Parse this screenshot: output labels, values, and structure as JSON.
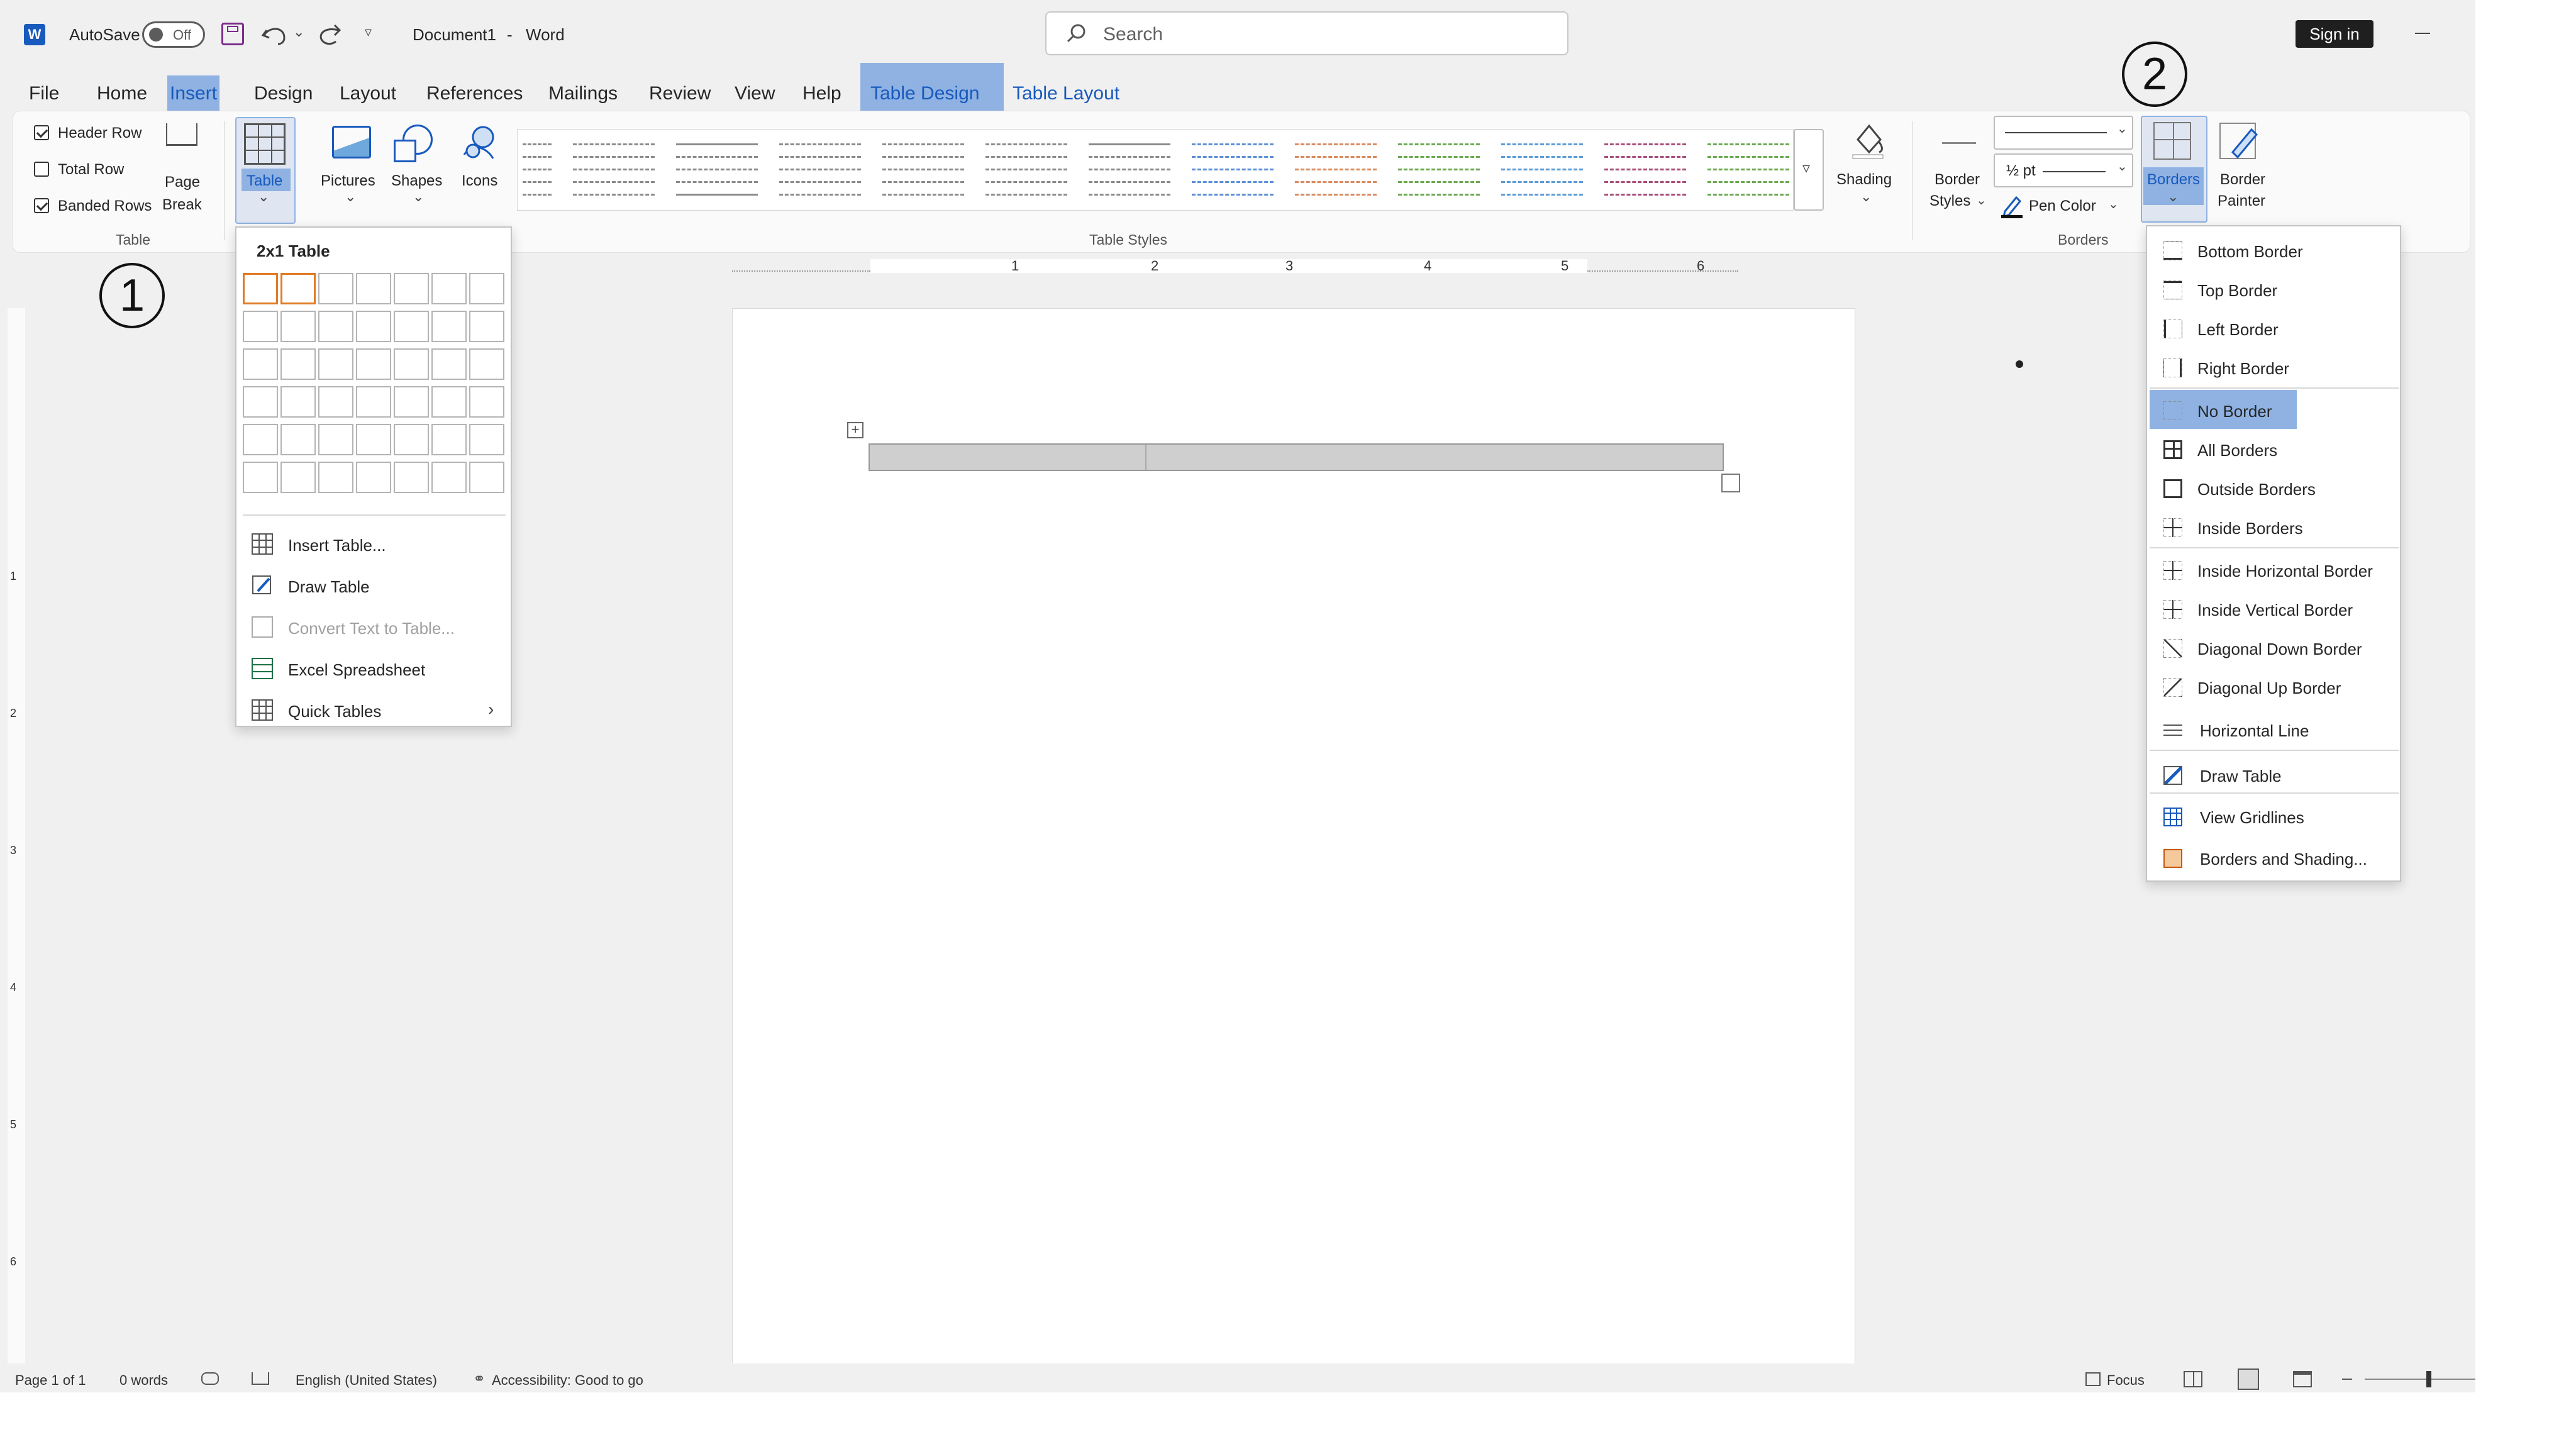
{
  "titlebar": {
    "autosave_label": "AutoSave",
    "autosave_state": "Off",
    "doc_title": "Document1",
    "separator": "-",
    "app_name": "Word",
    "search_placeholder": "Search",
    "signin": "Sign in"
  },
  "tabs": [
    "File",
    "Home",
    "Insert",
    "Design",
    "Layout",
    "References",
    "Mailings",
    "Review",
    "View",
    "Help",
    "Table Design",
    "Table Layout"
  ],
  "ribbon": {
    "header_row": "Header Row",
    "total_row": "Total Row",
    "banded_rows": "Banded Rows",
    "page_break_1": "Page",
    "page_break_2": "Break",
    "table": "Table",
    "pictures": "Pictures",
    "shapes": "Shapes",
    "icons": "Icons",
    "group_table": "Table",
    "group_table_styles": "Table Styles",
    "shading": "Shading",
    "border_styles_1": "Border",
    "border_styles_2": "Styles",
    "pen_weight": "½ pt",
    "pen_color": "Pen Color",
    "borders": "Borders",
    "border_painter_1": "Border",
    "border_painter_2": "Painter",
    "group_borders": "Borders"
  },
  "ruler": {
    "marks": [
      "1",
      "2",
      "3",
      "4",
      "5",
      "6"
    ],
    "vmarks": [
      "1",
      "2",
      "3",
      "4",
      "5",
      "6"
    ]
  },
  "table_menu": {
    "title": "2x1 Table",
    "items": [
      "Insert Table...",
      "Draw Table",
      "Convert Text to Table...",
      "Excel Spreadsheet",
      "Quick Tables"
    ]
  },
  "borders_menu": {
    "items": [
      "Bottom Border",
      "Top Border",
      "Left Border",
      "Right Border",
      "No Border",
      "All Borders",
      "Outside Borders",
      "Inside Borders",
      "Inside Horizontal Border",
      "Inside Vertical Border",
      "Diagonal Down Border",
      "Diagonal Up Border",
      "Horizontal Line",
      "Draw Table",
      "View Gridlines",
      "Borders and Shading..."
    ]
  },
  "annotations": {
    "one": "1",
    "two": "2"
  },
  "status": {
    "page": "Page 1 of 1",
    "words": "0 words",
    "language": "English (United States)",
    "accessibility": "Accessibility: Good to go",
    "focus": "Focus"
  },
  "colors": {
    "accent": "#185abd",
    "highlight": "#8fb2e3",
    "grid_select": "#e07b24"
  }
}
